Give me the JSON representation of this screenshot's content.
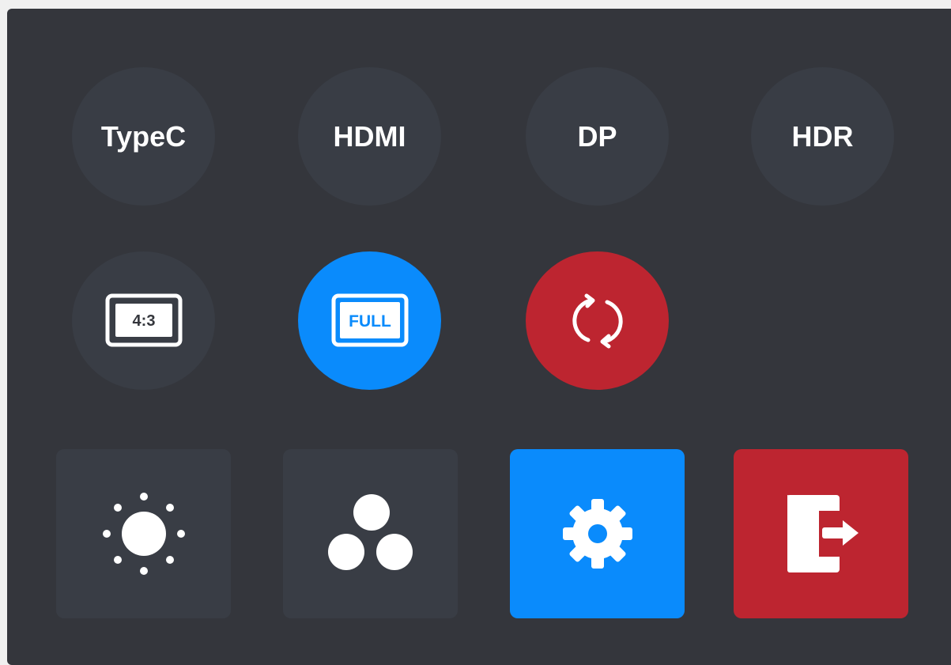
{
  "inputs": [
    {
      "label": "TypeC"
    },
    {
      "label": "HDMI"
    },
    {
      "label": "DP"
    },
    {
      "label": "HDR"
    }
  ],
  "aspect": {
    "ratio_label": "4:3",
    "full_label": "FULL",
    "refresh_icon": "refresh-icon"
  },
  "tiles": [
    {
      "icon": "brightness-icon"
    },
    {
      "icon": "color-balls-icon"
    },
    {
      "icon": "gear-icon"
    },
    {
      "icon": "exit-icon"
    }
  ],
  "colors": {
    "panel": "#34363c",
    "button": "#393d45",
    "accent_blue": "#0a8bfc",
    "accent_red": "#bd2530",
    "text": "#ffffff"
  }
}
